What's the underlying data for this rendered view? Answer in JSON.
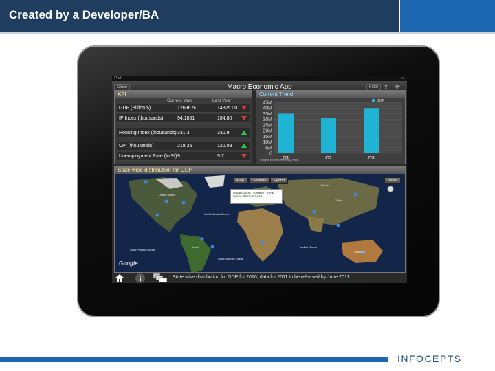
{
  "slide": {
    "title": "Created by a Developer/BA",
    "logo": "InfoCepts",
    "colors": {
      "header": "#1f3e5f",
      "accent": "#1d67b0"
    }
  },
  "app": {
    "status_left": "iPad",
    "nav_left": "Close",
    "title": "Macro Economic App",
    "nav_right": "Filter",
    "kpi": {
      "title": "KPI",
      "col_current": "Current Year",
      "col_last": "Last Year",
      "rows": [
        {
          "label": "GDP (Billion $)",
          "current": "12696.50",
          "last": "14825.00",
          "trend": "down"
        },
        {
          "label": "IP Index (thousands)",
          "current": "94.1851",
          "last": "184.80",
          "trend": "down"
        },
        {
          "label": "Housing Index (thousands)",
          "current": "331.3",
          "last": "330.9",
          "trend": "up"
        },
        {
          "label": "CPI (thousands)",
          "current": "218.25",
          "last": "120.08",
          "trend": "up"
        },
        {
          "label": "Unemployment Rate (In %)",
          "current": "9",
          "last": "9.7",
          "trend": "down"
        }
      ]
    },
    "trend": {
      "title": "Current Trend",
      "footnote": "Swipe to see History data"
    },
    "map": {
      "title": "State wise distribution for GDP",
      "controls": [
        "Map",
        "Satellite",
        "Hybrid"
      ],
      "sales_button": "Sales",
      "popup_org": "Organization : Geneve - IDHE",
      "popup_sales": "Sales : $969,867,211",
      "attribution": "Google",
      "continent_labels": [
        "Canada",
        "United States",
        "North Atlantic Ocean",
        "Brazil",
        "South Atlantic Ocean",
        "Indian Ocean",
        "Australia",
        "China",
        "Russia",
        "South Pacific Ocean"
      ]
    },
    "bottom_text": "State wise distribution for GDP for 2010, data for 2011 to be released by June 2011"
  },
  "chart_data": {
    "type": "bar",
    "categories": [
      "Q1",
      "Q2",
      "Q3"
    ],
    "series": [
      {
        "name": "GDP",
        "values": [
          35,
          31,
          40
        ]
      }
    ],
    "ylim": [
      0,
      45
    ],
    "yticks": [
      "0",
      "5M",
      "10M",
      "15M",
      "20M",
      "25M",
      "30M",
      "35M",
      "40M",
      "45M"
    ],
    "ytick_values": [
      0,
      5,
      10,
      15,
      20,
      25,
      30,
      35,
      40,
      45
    ],
    "bar_color": "#1fb3d4",
    "grid": true,
    "legend": "top-right"
  }
}
